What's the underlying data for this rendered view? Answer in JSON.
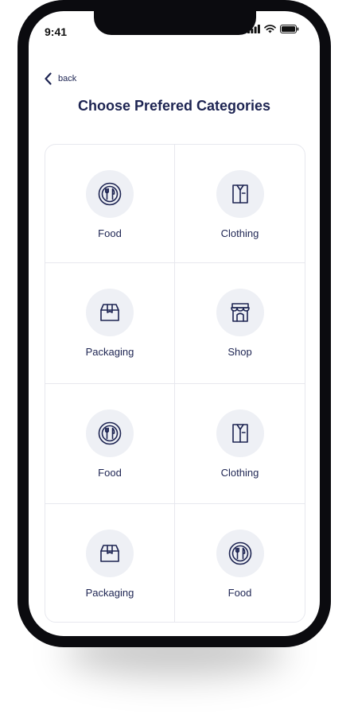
{
  "status": {
    "time": "9:41"
  },
  "nav": {
    "back_label": "back"
  },
  "page": {
    "title": "Choose Prefered Categories"
  },
  "categories": [
    {
      "label": "Food",
      "icon": "food-icon"
    },
    {
      "label": "Clothing",
      "icon": "clothing-icon"
    },
    {
      "label": "Packaging",
      "icon": "packaging-icon"
    },
    {
      "label": "Shop",
      "icon": "shop-icon"
    },
    {
      "label": "Food",
      "icon": "food-icon"
    },
    {
      "label": "Clothing",
      "icon": "clothing-icon"
    },
    {
      "label": "Packaging",
      "icon": "packaging-icon"
    },
    {
      "label": "Food",
      "icon": "food-icon"
    }
  ],
  "colors": {
    "accent": "#1d2452",
    "icon_bg": "#eef0f5",
    "border": "#e7e8ee"
  }
}
